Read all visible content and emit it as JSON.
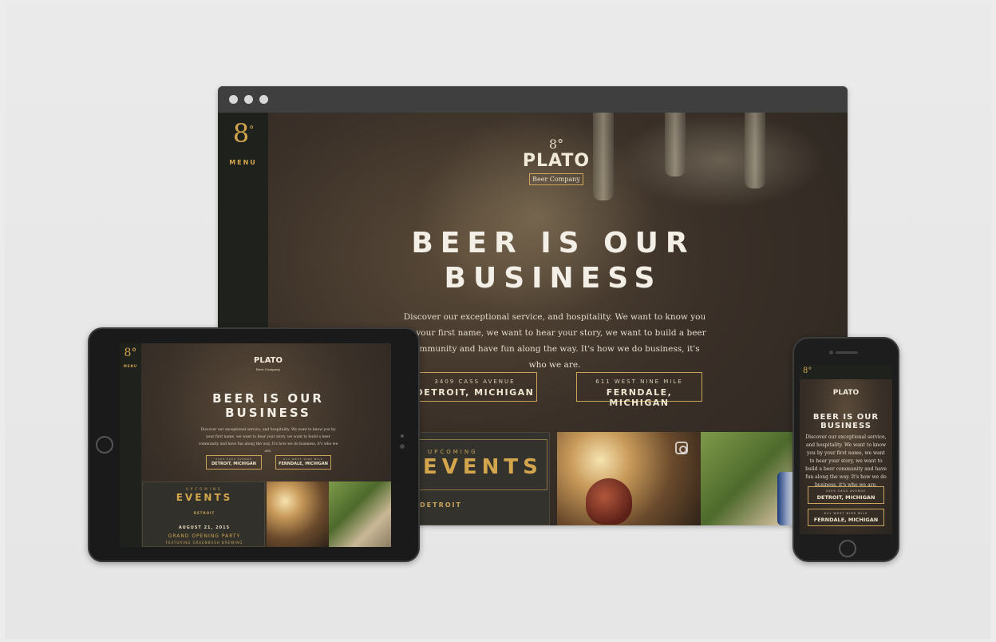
{
  "brand": {
    "mark": "8",
    "degree": "°",
    "name": "PLATO",
    "sub": "Beer Company"
  },
  "nav": {
    "menu_label": "MENU"
  },
  "hero": {
    "title_line1": "BEER IS OUR",
    "title_line2": "BUSINESS",
    "body": "Discover our exceptional service, and hospitality. We want to know you by your first name, we want to hear your story, we want to build a beer community and have fun along the way. It's how we do business, it's who we are."
  },
  "locations": [
    {
      "address": "3409 CASS AVENUE",
      "city": "DETROIT, MICHIGAN"
    },
    {
      "address": "611 WEST NINE MILE",
      "city": "FERNDALE, MICHIGAN"
    }
  ],
  "events": {
    "eyebrow": "UPCOMING",
    "title": "EVENTS",
    "city": "DETROIT",
    "date": "AUGUST 21, 2015",
    "event_name": "GRAND OPENING PARTY",
    "featuring": "FEATURING GREENBUSH BREWING"
  },
  "icons": [
    "instagram-icon",
    "window-dots"
  ]
}
